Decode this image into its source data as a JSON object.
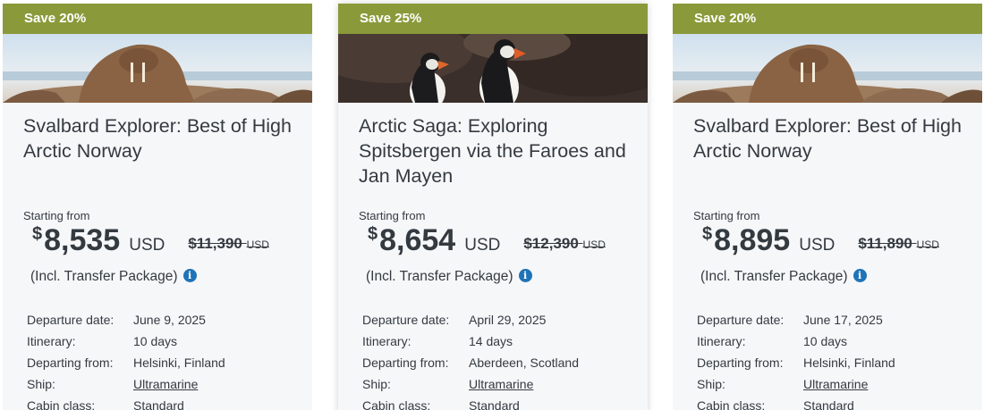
{
  "cards": [
    {
      "badge": "Save 20%",
      "photo": "walrus-photo",
      "title": "Svalbard Explorer: Best of High Arctic Norway",
      "starting_from": "Starting from",
      "currency_symbol": "$",
      "price": "8,535",
      "currency": "USD",
      "old_price": "$11,390",
      "old_currency": "USD",
      "transfer": "(Incl. Transfer Package)",
      "details": [
        {
          "label": "Departure date:",
          "value": "June 9, 2025"
        },
        {
          "label": "Itinerary:",
          "value": "10 days"
        },
        {
          "label": "Departing from:",
          "value": "Helsinki, Finland"
        },
        {
          "label": "Ship:",
          "value": "Ultramarine"
        },
        {
          "label": "Cabin class:",
          "value": "Standard"
        }
      ]
    },
    {
      "badge": "Save 25%",
      "photo": "puffin-photo",
      "title": "Arctic Saga: Exploring Spitsbergen via the Faroes and Jan Mayen",
      "starting_from": "Starting from",
      "currency_symbol": "$",
      "price": "8,654",
      "currency": "USD",
      "old_price": "$12,390",
      "old_currency": "USD",
      "transfer": "(Incl. Transfer Package)",
      "details": [
        {
          "label": "Departure date:",
          "value": "April 29, 2025"
        },
        {
          "label": "Itinerary:",
          "value": "14 days"
        },
        {
          "label": "Departing from:",
          "value": "Aberdeen, Scotland"
        },
        {
          "label": "Ship:",
          "value": "Ultramarine"
        },
        {
          "label": "Cabin class:",
          "value": "Standard"
        }
      ]
    },
    {
      "badge": "Save 20%",
      "photo": "walrus-photo",
      "title": "Svalbard Explorer: Best of High Arctic Norway",
      "starting_from": "Starting from",
      "currency_symbol": "$",
      "price": "8,895",
      "currency": "USD",
      "old_price": "$11,890",
      "old_currency": "USD",
      "transfer": "(Incl. Transfer Package)",
      "details": [
        {
          "label": "Departure date:",
          "value": "June 17, 2025"
        },
        {
          "label": "Itinerary:",
          "value": "10 days"
        },
        {
          "label": "Departing from:",
          "value": "Helsinki, Finland"
        },
        {
          "label": "Ship:",
          "value": "Ultramarine"
        },
        {
          "label": "Cabin class:",
          "value": "Standard"
        }
      ]
    }
  ],
  "colors": {
    "banner": "#8a9a3a",
    "card_bg": "#f6f7f9",
    "text": "#333a40",
    "info_icon": "#1f73b7"
  },
  "icons": {
    "info": "info-icon"
  }
}
